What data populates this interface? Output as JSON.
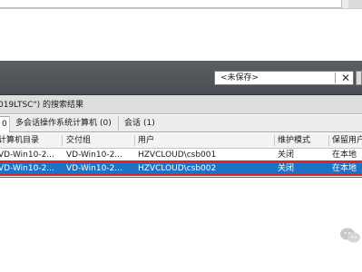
{
  "combo": {
    "value": "<未保存>",
    "clear_icon": "close-icon"
  },
  "results": {
    "title": "019LTSC\") 的搜索结果"
  },
  "tabs": [
    {
      "label": "0",
      "active": true
    },
    {
      "label": "多会话操作系统计算机",
      "count": "(0)"
    },
    {
      "label": "会话",
      "count": "(1)"
    }
  ],
  "columns": [
    "计算机目录",
    "交付组",
    "用户",
    "维护模式",
    "保留用户"
  ],
  "rows": [
    {
      "catalog": "VD-Win10-2...",
      "group": "VD-Win10-2...",
      "user": "HZVCLOUD\\csb001",
      "maintenance": "关闭",
      "keep": "在本地",
      "selected": false
    },
    {
      "catalog": "VD-Win10-2...",
      "group": "VD-Win10-2...",
      "user": "HZVCLOUD\\csb002",
      "maintenance": "关闭",
      "keep": "在本地",
      "selected": true
    }
  ],
  "colors": {
    "selection": "#1a73c4",
    "highlight": "#d8232a",
    "toolbar": "#53575b"
  },
  "watermark": {
    "icon": "wechat-icon"
  }
}
